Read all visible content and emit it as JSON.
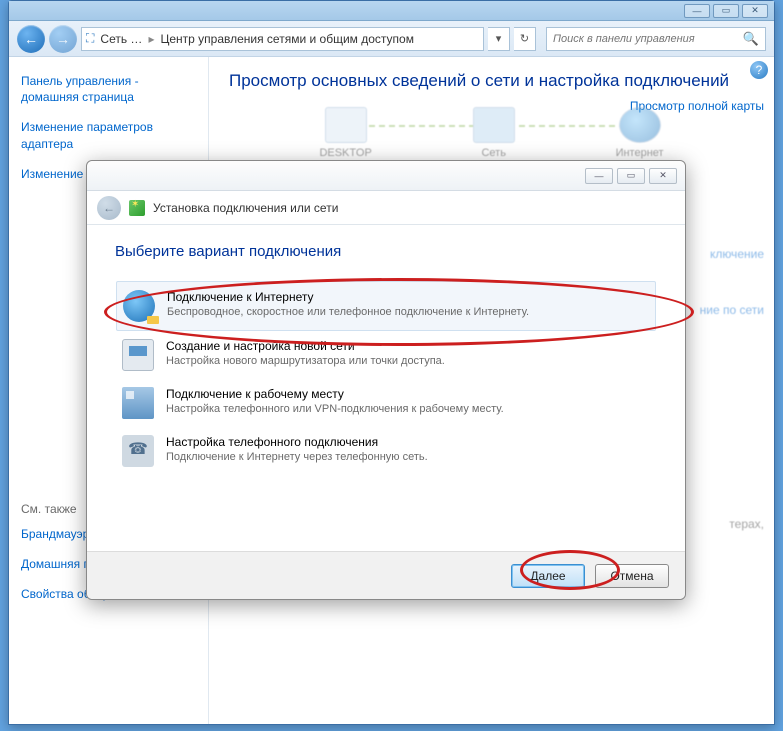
{
  "titlebar": {
    "min": "—",
    "max": "▭",
    "close": "✕"
  },
  "nav": {
    "back": "←",
    "forward": "→",
    "crumb1": "Сеть …",
    "crumb2": "Центр управления сетями и общим доступом",
    "refresh": "↻",
    "dropdown": "▾"
  },
  "search": {
    "placeholder": "Поиск в панели управления",
    "icon": "🔍"
  },
  "sidebar": {
    "home": "Панель управления - домашняя страница",
    "adapter": "Изменение параметров адаптера",
    "sharing": "Изменение параметров",
    "see_also": "См. также",
    "firewall": "Брандмауэр Windows",
    "homegroup": "Домашняя группа",
    "inetopts": "Свойства обозревателя"
  },
  "main": {
    "heading": "Просмотр основных сведений о сети и настройка подключений",
    "node1": "DESKTOP",
    "node2": "Сеть",
    "node3": "Интернет",
    "fullmap": "Просмотр полной карты",
    "connect": "ключение",
    "newconn_frag": "ние по сети",
    "printers_frag": "терах,"
  },
  "dialog": {
    "winmin": "—",
    "winmax": "▭",
    "winclose": "✕",
    "back": "←",
    "title": "Установка подключения или сети",
    "heading": "Выберите вариант подключения",
    "opt1_t": "Подключение к Интернету",
    "opt1_d": "Беспроводное, скоростное или телефонное подключение к Интернету.",
    "opt2_t": "Создание и настройка новой сети",
    "opt2_d": "Настройка нового маршрутизатора или точки доступа.",
    "opt3_t": "Подключение к рабочему месту",
    "opt3_d": "Настройка телефонного или VPN-подключения к рабочему месту.",
    "opt4_t": "Настройка телефонного подключения",
    "opt4_d": "Подключение к Интернету через телефонную сеть.",
    "next": "Далее",
    "cancel": "Отмена"
  },
  "help": "?"
}
